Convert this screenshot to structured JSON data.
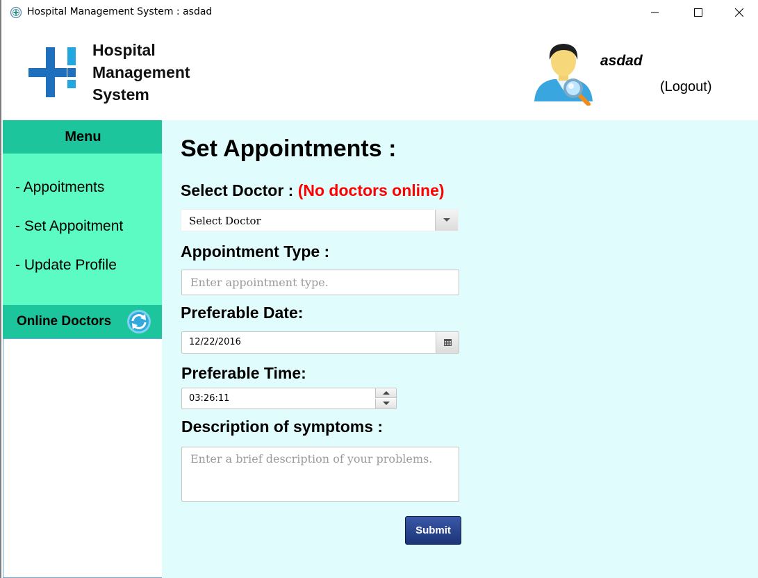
{
  "window": {
    "title": "Hospital Management System : asdad",
    "controls": [
      "minimize",
      "maximize",
      "close"
    ]
  },
  "header": {
    "brand_lines": [
      "Hospital",
      "Management",
      "System"
    ],
    "logo_color": "#1f6fbf",
    "user_name": "asdad",
    "logout_label": "(Logout)"
  },
  "sidebar": {
    "menu_title": "Menu",
    "items": [
      {
        "label": "- Appoitments"
      },
      {
        "label": "- Set Appoitment"
      },
      {
        "label": "- Update Profile"
      }
    ],
    "online_title": "Online Doctors",
    "online_doctors": [],
    "accent": "#1cc59b",
    "menu_bg": "#5cfbc4"
  },
  "main": {
    "title": "Set Appointments :",
    "bg": "#e0fcfd",
    "doctor": {
      "label": "Select Doctor :",
      "status": "(No doctors online)",
      "status_color": "#ff0000",
      "selected": "Select Doctor"
    },
    "appointment_type": {
      "label": "Appointment Type :",
      "placeholder": "Enter appointment type.",
      "value": ""
    },
    "date": {
      "label": "Preferable Date:",
      "value": "12/22/2016"
    },
    "time": {
      "label": "Preferable Time:",
      "value": "03:26:11"
    },
    "symptoms": {
      "label": "Description of symptoms :",
      "placeholder": "Enter a brief description of your problems.",
      "value": ""
    },
    "submit_label": "Submit"
  }
}
